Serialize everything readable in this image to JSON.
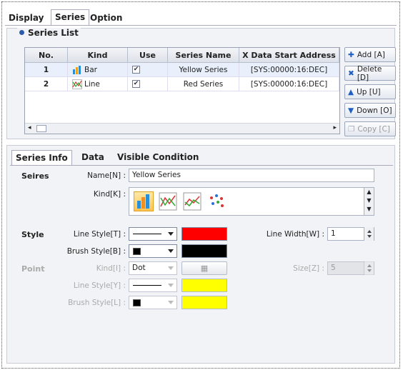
{
  "top_tabs": [
    {
      "label": "Display"
    },
    {
      "label": "Series"
    },
    {
      "label": "Option"
    }
  ],
  "series_list": {
    "title": "Series List",
    "columns": [
      "No.",
      "Kind",
      "Use",
      "Series Name",
      "X Data Start Address"
    ],
    "rows": [
      {
        "no": "1",
        "kind": "Bar",
        "use": true,
        "name": "Yellow Series",
        "address": "[SYS:00000:16:DEC]"
      },
      {
        "no": "2",
        "kind": "Line",
        "use": true,
        "name": "Red Series",
        "address": "[SYS:00000:16:DEC]"
      }
    ],
    "buttons": {
      "add": "Add [A]",
      "delete": "Delete [D]",
      "up": "Up [U]",
      "down": "Down [O]",
      "copy": "Copy [C]"
    }
  },
  "info_tabs": [
    {
      "label": "Series Info"
    },
    {
      "label": "Data"
    },
    {
      "label": "Visible Condition"
    }
  ],
  "series_section": {
    "label": "Seires",
    "name_label": "Name[N] :",
    "name_value": "Yellow Series",
    "kind_label": "Kind[K] :",
    "kinds": [
      "bar-chart-icon",
      "line-chart-icon",
      "area-chart-icon",
      "scatter-chart-icon"
    ]
  },
  "style_section": {
    "label": "Style",
    "line_style_label": "Line Style[T] :",
    "line_color": "#ff0000",
    "brush_style_label": "Brush Style[B] :",
    "brush_color": "#000000",
    "line_width_label": "Line Width[W] :",
    "line_width": "1"
  },
  "point_section": {
    "label": "Point",
    "kind_label": "Kind[I] :",
    "kind_value": "Dot",
    "size_label": "Size[Z] :",
    "size_value": "5",
    "line_style_label": "Line Style[Y] :",
    "line_color": "#ffff00",
    "brush_style_label": "Brush Style[L] :",
    "brush_color": "#ffff00"
  }
}
